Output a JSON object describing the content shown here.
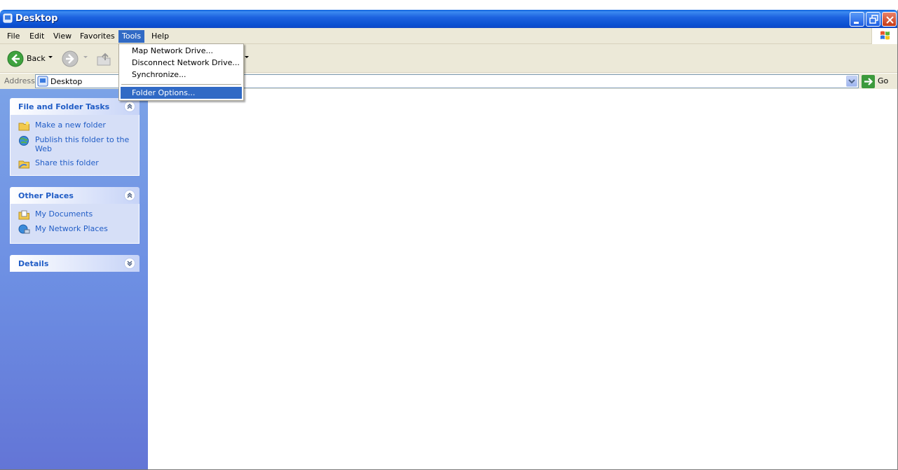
{
  "window": {
    "title": "Desktop",
    "icon": "folder-desktop-icon",
    "title_color": "#0a4fd0"
  },
  "menubar": {
    "items": [
      "File",
      "Edit",
      "View",
      "Favorites",
      "Tools",
      "Help"
    ],
    "active": "Tools"
  },
  "toolbar": {
    "back_label": "Back"
  },
  "addressbar": {
    "label": "Address",
    "value": "Desktop",
    "go_label": "Go"
  },
  "tools_menu": {
    "items": [
      "Map Network Drive...",
      "Disconnect Network Drive...",
      "Synchronize...",
      "Folder Options..."
    ],
    "highlighted": "Folder Options..."
  },
  "left_pane": {
    "file_tasks": {
      "title": "File and Folder Tasks",
      "items": [
        "Make a new folder",
        "Publish this folder to the Web",
        "Share this folder"
      ]
    },
    "other_places": {
      "title": "Other Places",
      "items": [
        "My Documents",
        "My Network Places"
      ]
    },
    "details": {
      "title": "Details"
    }
  },
  "colors": {
    "accent": "#316ac5",
    "link": "#215dc6",
    "chrome": "#ece9d8"
  }
}
